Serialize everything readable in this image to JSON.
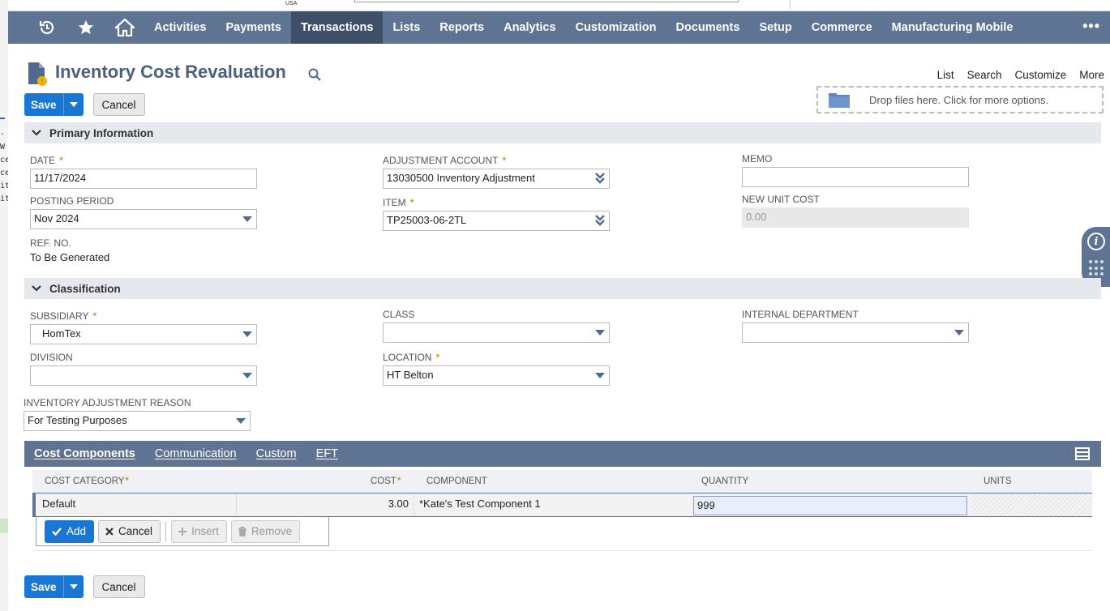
{
  "top": {
    "logo_text": "USA",
    "bg_fragments": [
      "-",
      "W",
      "ce",
      "ce",
      "it",
      "it"
    ]
  },
  "nav": {
    "icons": [
      "history-icon",
      "star-icon",
      "home-icon"
    ],
    "items": [
      {
        "label": "Activities",
        "active": false
      },
      {
        "label": "Payments",
        "active": false
      },
      {
        "label": "Transactions",
        "active": true
      },
      {
        "label": "Lists",
        "active": false
      },
      {
        "label": "Reports",
        "active": false
      },
      {
        "label": "Analytics",
        "active": false
      },
      {
        "label": "Customization",
        "active": false
      },
      {
        "label": "Documents",
        "active": false
      },
      {
        "label": "Setup",
        "active": false
      },
      {
        "label": "Commerce",
        "active": false
      },
      {
        "label": "Manufacturing Mobile",
        "active": false
      }
    ],
    "more": "•••"
  },
  "header": {
    "title": "Inventory Cost Revaluation",
    "links": [
      "List",
      "Search",
      "Customize",
      "More"
    ],
    "dropzone_text": "Drop files here. Click for more options."
  },
  "buttons": {
    "save": "Save",
    "cancel": "Cancel"
  },
  "primary": {
    "title": "Primary Information",
    "date_label": "DATE",
    "date_value": "11/17/2024",
    "posting_label": "POSTING PERIOD",
    "posting_value": "Nov 2024",
    "refno_label": "REF. NO.",
    "refno_value": "To Be Generated",
    "account_label": "ADJUSTMENT ACCOUNT",
    "account_value": "13030500 Inventory Adjustment",
    "item_label": "ITEM",
    "item_value": "TP25003-06-2TL",
    "memo_label": "MEMO",
    "memo_value": "",
    "unitcost_label": "NEW UNIT COST",
    "unitcost_value": "0.00"
  },
  "classification": {
    "title": "Classification",
    "subsidiary_label": "SUBSIDIARY",
    "subsidiary_value": "HomTex",
    "division_label": "DIVISION",
    "division_value": "",
    "class_label": "CLASS",
    "class_value": "",
    "location_label": "LOCATION",
    "location_value": "HT Belton",
    "dept_label": "INTERNAL DEPARTMENT",
    "dept_value": "",
    "reason_label": "INVENTORY ADJUSTMENT REASON",
    "reason_value": "For Testing Purposes"
  },
  "subtabs": [
    "Cost Components",
    "Communication",
    "Custom",
    "EFT"
  ],
  "grid": {
    "headers": [
      "COST CATEGORY",
      "COST",
      "COMPONENT",
      "QUANTITY",
      "UNITS"
    ],
    "rows": [
      {
        "category": "Default",
        "cost": "3.00",
        "component": "*Kate's Test Component 1",
        "quantity": "999",
        "units": ""
      }
    ],
    "actions": {
      "add": "Add",
      "cancel": "Cancel",
      "insert": "Insert",
      "remove": "Remove"
    }
  },
  "colors": {
    "nav_bg": "#5f7392",
    "nav_active": "#3f4f68",
    "primary_button": "#1976d2",
    "required_star": "#d19a2a",
    "title_text": "#4d5f7a"
  }
}
